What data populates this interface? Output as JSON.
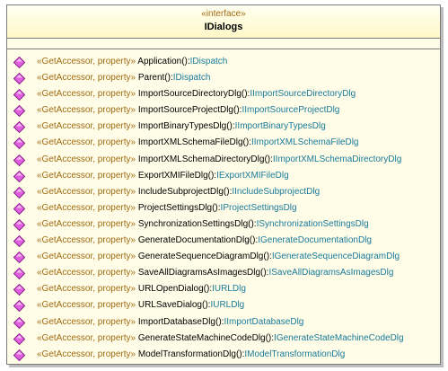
{
  "diagram": {
    "stereotype": "«interface»",
    "class_name": "IDialogs",
    "operations": [
      {
        "stereotype": "«GetAccessor, property»",
        "signature": "Application():",
        "type": "IDispatch"
      },
      {
        "stereotype": "«GetAccessor, property»",
        "signature": "Parent():",
        "type": "IDispatch"
      },
      {
        "stereotype": "«GetAccessor, property»",
        "signature": "ImportSourceDirectoryDlg():",
        "type": "IImportSourceDirectoryDlg"
      },
      {
        "stereotype": "«GetAccessor, property»",
        "signature": "ImportSourceProjectDlg():",
        "type": "IImportSourceProjectDlg"
      },
      {
        "stereotype": "«GetAccessor, property»",
        "signature": "ImportBinaryTypesDlg():",
        "type": "IImportBinaryTypesDlg"
      },
      {
        "stereotype": "«GetAccessor, property»",
        "signature": "ImportXMLSchemaFileDlg():",
        "type": "IImportXMLSchemaFileDlg"
      },
      {
        "stereotype": "«GetAccessor, property»",
        "signature": "ImportXMLSchemaDirectoryDlg():",
        "type": "IImportXMLSchemaDirectoryDlg"
      },
      {
        "stereotype": "«GetAccessor, property»",
        "signature": "ExportXMIFileDlg():",
        "type": "IExportXMIFileDlg"
      },
      {
        "stereotype": "«GetAccessor, property»",
        "signature": "IncludeSubprojectDlg():",
        "type": "IIncludeSubprojectDlg"
      },
      {
        "stereotype": "«GetAccessor, property»",
        "signature": "ProjectSettingsDlg():",
        "type": "IProjectSettingsDlg"
      },
      {
        "stereotype": "«GetAccessor, property»",
        "signature": "SynchronizationSettingsDlg():",
        "type": "ISynchronizationSettingsDlg"
      },
      {
        "stereotype": "«GetAccessor, property»",
        "signature": "GenerateDocumentationDlg():",
        "type": "IGenerateDocumentationDlg"
      },
      {
        "stereotype": "«GetAccessor, property»",
        "signature": "GenerateSequenceDiagramDlg():",
        "type": "IGenerateSequenceDiagramDlg"
      },
      {
        "stereotype": "«GetAccessor, property»",
        "signature": "SaveAllDiagramsAsImagesDlg():",
        "type": "ISaveAllDiagramsAsImagesDlg"
      },
      {
        "stereotype": "«GetAccessor, property»",
        "signature": "URLOpenDialog():",
        "type": "IURLDlg"
      },
      {
        "stereotype": "«GetAccessor, property»",
        "signature": "URLSaveDialog():",
        "type": "IURLDlg"
      },
      {
        "stereotype": "«GetAccessor, property»",
        "signature": "ImportDatabaseDlg():",
        "type": "IImportDatabaseDlg"
      },
      {
        "stereotype": "«GetAccessor, property»",
        "signature": "GenerateStateMachineCodeDlg():",
        "type": "IGenerateStateMachineCodeDlg"
      },
      {
        "stereotype": "«GetAccessor, property»",
        "signature": "ModelTransformationDlg():",
        "type": "IModelTransformationDlg"
      }
    ]
  },
  "colors": {
    "stereotype": "#a06a10",
    "type": "#1a7a9a",
    "icon_fill": "#e060e0",
    "icon_stroke": "#8a208a",
    "header_fill": "#fff8c8",
    "body_fill": "#fffde8"
  },
  "icons": {
    "operation": "public-operation-diamond-icon"
  }
}
